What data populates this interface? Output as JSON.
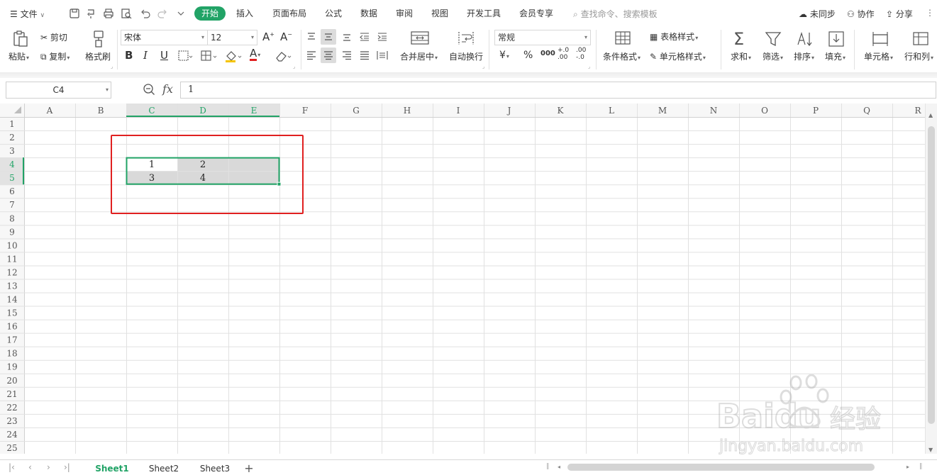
{
  "menubar": {
    "file_label": "文件",
    "tabs": [
      "开始",
      "插入",
      "页面布局",
      "公式",
      "数据",
      "审阅",
      "视图",
      "开发工具",
      "会员专享"
    ],
    "active_tab": "开始",
    "search_placeholder": "查找命令、搜索模板",
    "sync_label": "未同步",
    "collab_label": "协作",
    "share_label": "分享"
  },
  "ribbon": {
    "paste_label": "粘贴",
    "cut_label": "剪切",
    "copy_label": "复制",
    "format_painter_label": "格式刷",
    "font_name": "宋体",
    "font_size": "12",
    "bold": "B",
    "italic": "I",
    "underline": "U",
    "font_color_letter": "A",
    "merge_center_label": "合并居中",
    "wrap_text_label": "自动换行",
    "number_format": "常规",
    "currency": "¥",
    "percent": "%",
    "thousands": "000",
    "inc_decimal": "+.0\n.00",
    "dec_decimal": ".00\n-.0",
    "conditional_format_label": "条件格式",
    "table_style_label": "表格样式",
    "cell_style_label": "单元格样式",
    "sum_label": "求和",
    "filter_label": "筛选",
    "sort_label": "排序",
    "fill_label": "填充",
    "cell_label": "单元格",
    "rowcol_label": "行和列"
  },
  "formula_bar": {
    "name_box": "C4",
    "fx_label": "fx",
    "content": "1"
  },
  "grid": {
    "columns": [
      "A",
      "B",
      "C",
      "D",
      "E",
      "F",
      "G",
      "H",
      "I",
      "J",
      "K",
      "L",
      "M",
      "N",
      "O",
      "P",
      "Q",
      "R"
    ],
    "rows": [
      "1",
      "2",
      "3",
      "4",
      "5",
      "6",
      "7",
      "8",
      "9",
      "10",
      "11",
      "12",
      "13",
      "14",
      "15",
      "16",
      "17",
      "18",
      "19",
      "20",
      "21",
      "22",
      "23",
      "24",
      "25"
    ],
    "cells": {
      "C4": "1",
      "D4": "2",
      "C5": "3",
      "D5": "4"
    },
    "selection": "C4:E5",
    "selection_color": "#21a366",
    "selected_fill": "#d9d9d9"
  },
  "sheets": [
    "Sheet1",
    "Sheet2",
    "Sheet3"
  ],
  "active_sheet": "Sheet1",
  "add_sheet": "+",
  "watermark": {
    "brand": "Baidu",
    "cn": "经验",
    "url": "jingyan.baidu.com"
  },
  "colors": {
    "accent": "#21a366",
    "annotation": "#e02020"
  }
}
